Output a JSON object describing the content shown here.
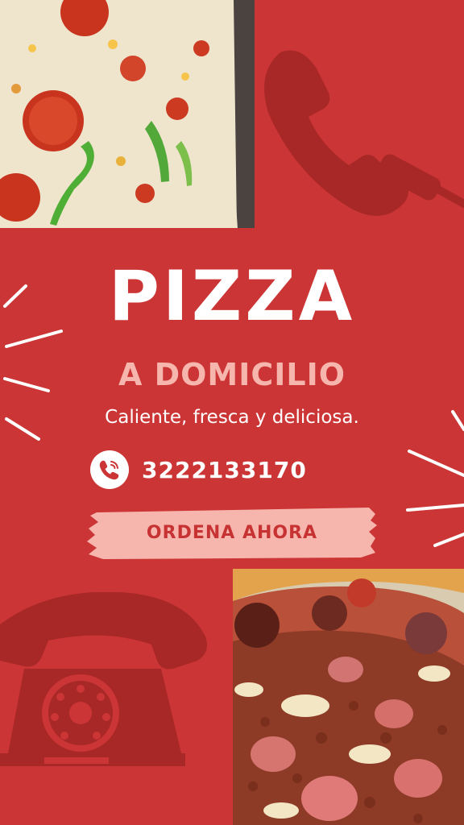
{
  "poster": {
    "title": "PIZZA",
    "subtitle": "A DOMICILIO",
    "tagline": "Caliente, fresca y deliciosa.",
    "phone_number": "3222133170",
    "cta_label": "ORDENA AHORA"
  },
  "colors": {
    "background": "#cc3535",
    "deco_dark": "#a82828",
    "accent_pink": "#f6b6ad",
    "white": "#ffffff"
  },
  "icons": {
    "phone_badge": "phone-icon",
    "handset_deco": "telephone-handset-icon",
    "rotary_deco": "rotary-telephone-icon"
  }
}
